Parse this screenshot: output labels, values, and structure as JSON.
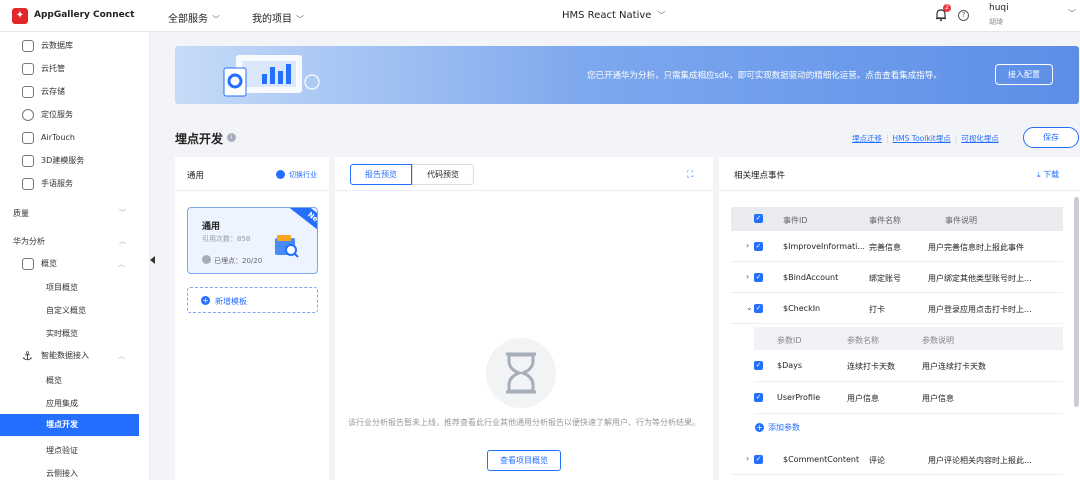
{
  "topbar": {
    "logo_glyph": "✦",
    "app_name": "AppGallery Connect",
    "nav": [
      {
        "label": "全部服务"
      },
      {
        "label": "我的项目"
      }
    ],
    "project": "HMS React Native",
    "notification_count": "2",
    "help_glyph": "?",
    "user_name": "huqi",
    "user_sub": "胡琦"
  },
  "sidebar": {
    "items": [
      {
        "label": "云数据库",
        "icon": "database-icon"
      },
      {
        "label": "云托管",
        "icon": "hosting-icon"
      },
      {
        "label": "云存储",
        "icon": "storage-icon"
      },
      {
        "label": "定位服务",
        "icon": "location-icon"
      },
      {
        "label": "AirTouch",
        "icon": "airtouch-icon"
      },
      {
        "label": "3D建模服务",
        "icon": "modeling-icon"
      },
      {
        "label": "手语服务",
        "icon": "sign-language-icon"
      }
    ],
    "groups": [
      {
        "label": "质量"
      },
      {
        "label": "华为分析"
      }
    ],
    "overview": "概览",
    "overview_sub": [
      "项目概览",
      "自定义概览",
      "实时概览"
    ],
    "smart": "智能数据接入",
    "smart_sub": [
      "概览",
      "应用集成",
      "埋点开发",
      "埋点验证",
      "云侧接入"
    ],
    "active": "埋点开发"
  },
  "banner": {
    "text": "您已开通华为分析，只需集成相应sdk，即可实现数据驱动的精细化运营。点击查看集成指导。",
    "button": "接入配置"
  },
  "page": {
    "title": "埋点开发",
    "info_glyph": "i",
    "links": [
      "埋点迁移",
      "HMS Toolkit埋点",
      "可视化埋点"
    ],
    "save": "保存"
  },
  "template_panel": {
    "title": "通用",
    "switch": "切换行业",
    "card": {
      "name": "通用",
      "count": "引用次数：858",
      "status": "已埋点：20/20",
      "badge": "New"
    },
    "add": "新增模板"
  },
  "report_panel": {
    "tabs": [
      "报告预览",
      "代码预览"
    ],
    "expand_glyph": "⛶",
    "empty_text": "该行业分析报告暂未上线，推荐查看此行业其他通用分析报告以便快速了解用户、行为等分析结果。",
    "view_button": "查看项目概览"
  },
  "events_panel": {
    "title": "相关埋点事件",
    "download": "下载",
    "headers": [
      "事件ID",
      "事件名称",
      "事件说明"
    ],
    "rows": [
      {
        "id": "$ImproveInformati...",
        "name": "完善信息",
        "desc": "用户完善信息时上报此事件",
        "arrow": "›"
      },
      {
        "id": "$BindAccount",
        "name": "绑定账号",
        "desc": "用户绑定其他类型账号时上...",
        "arrow": "›"
      },
      {
        "id": "$CheckIn",
        "name": "打卡",
        "desc": "用户登录应用点击打卡时上...",
        "arrow": "⌄"
      },
      {
        "id": "$CommentContent",
        "name": "评论",
        "desc": "用户评论相关内容时上报此...",
        "arrow": "›"
      }
    ],
    "param_headers": [
      "参数ID",
      "参数名称",
      "参数说明"
    ],
    "params": [
      {
        "id": "$Days",
        "name": "连续打卡天数",
        "desc": "用户连续打卡天数"
      },
      {
        "id": "UserProfile",
        "name": "用户信息",
        "desc": "用户信息"
      }
    ],
    "add_param": "添加参数",
    "check_glyph": "✓"
  },
  "colors": {
    "accent": "#256fff",
    "alert": "#e8383d"
  }
}
